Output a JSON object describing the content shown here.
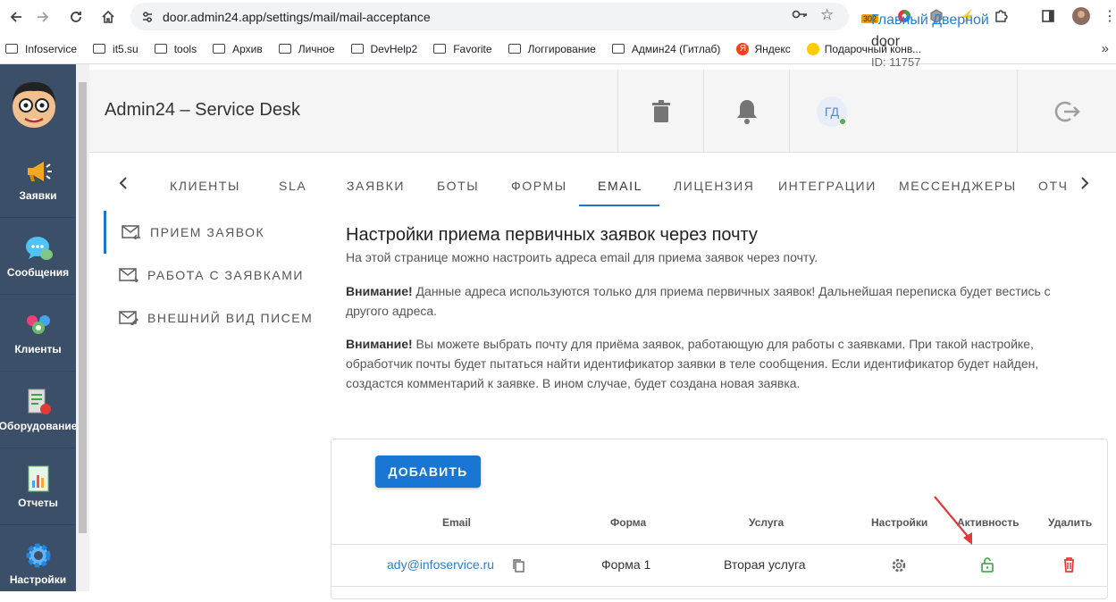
{
  "browser": {
    "url": "door.admin24.app/settings/mail/mail-acceptance",
    "ext_badge": "302",
    "bookmarks": [
      "Infoservice",
      "it5.su",
      "tools",
      "Архив",
      "Личное",
      "DevHelp2",
      "Favorite",
      "Логгирование",
      "Админ24 (Гитлаб)",
      "Яндекс",
      "Подарочный конв..."
    ]
  },
  "sidebar": {
    "items": [
      {
        "label": "Заявки",
        "icon": "megaphone-icon"
      },
      {
        "label": "Сообщения",
        "icon": "chat-icon"
      },
      {
        "label": "Клиенты",
        "icon": "clients-icon"
      },
      {
        "label": "Оборудование",
        "icon": "equipment-icon"
      },
      {
        "label": "Отчеты",
        "icon": "reports-icon"
      },
      {
        "label": "Настройки",
        "icon": "settings-icon"
      }
    ]
  },
  "header": {
    "title": "Admin24 – Service Desk",
    "user": {
      "initials": "ГД",
      "name": "Главный Дверной",
      "login": "door",
      "id": "ID: 11757"
    }
  },
  "tabs": [
    "КЛИЕНТЫ",
    "SLA",
    "ЗАЯВКИ",
    "БОТЫ",
    "ФОРМЫ",
    "EMAIL",
    "ЛИЦЕНЗИЯ",
    "ИНТЕГРАЦИИ",
    "МЕССЕНДЖЕРЫ",
    "ОТЧ"
  ],
  "submenu": [
    "ПРИЕМ ЗАЯВОК",
    "РАБОТА С ЗАЯВКАМИ",
    "ВНЕШНИЙ ВИД ПИСЕМ"
  ],
  "content": {
    "title": "Настройки приема первичных заявок через почту",
    "intro": "На этой странице можно настроить адреса email для приема заявок через почту.",
    "warn1_label": "Внимание!",
    "warn1_line1": " Данные адреса используются только для приема первичных заявок! Дальнейшая переписка будет вестись с",
    "warn1_line2": "другого адреса.",
    "warn2_label": "Внимание!",
    "warn2_line1": " Вы можете выбрать почту для приёма заявок, работающую для работы с заявками. При такой настройке,",
    "warn2_line2": "обработчик почты будет пытаться найти идентификатор заявки в теле сообщения. Если идентификатор будет найден,",
    "warn2_line3": "создастся комментарий к заявке. В ином случае, будет создана новая заявка."
  },
  "table": {
    "add_label": "ДОБАВИТЬ",
    "columns": [
      "Email",
      "Форма",
      "Услуга",
      "Настройки",
      "Активность",
      "Удалить"
    ],
    "rows": [
      {
        "email": "ady@infoservice.ru",
        "form": "Форма 1",
        "service": "Вторая услуга",
        "active": true
      }
    ]
  },
  "colors": {
    "accent": "#1976d2",
    "sidebar": "#3c4f68",
    "active_green": "#4caf50",
    "delete_red": "#e53935",
    "arrow_red": "#e53935"
  }
}
